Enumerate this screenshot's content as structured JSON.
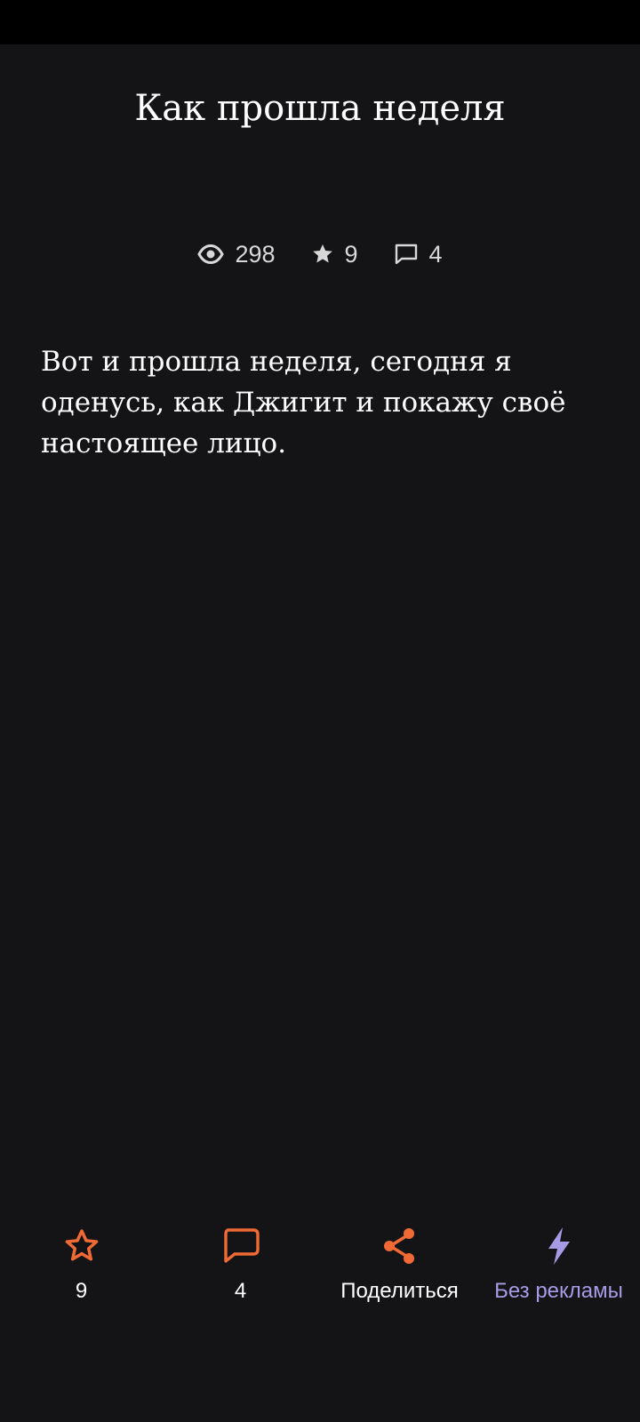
{
  "post": {
    "title": "Как прошла неделя",
    "body": "Вот и прошла неделя, сегодня я оденусь, как Джигит и покажу своё настоящее лицо."
  },
  "stats": {
    "views": "298",
    "favorites": "9",
    "comments": "4"
  },
  "actions": {
    "favorite_count": "9",
    "comment_count": "4",
    "share_label": "Поделиться",
    "no_ads_label": "Без рекламы"
  },
  "icons": {
    "views": "eye-icon",
    "favorites": "star-icon",
    "comments": "comment-icon",
    "share": "share-icon",
    "no_ads": "lightning-icon"
  },
  "colors": {
    "background": "#141316",
    "accent": "#f06a35",
    "premium": "#a79be6",
    "stat_text": "#d8d8d8"
  }
}
